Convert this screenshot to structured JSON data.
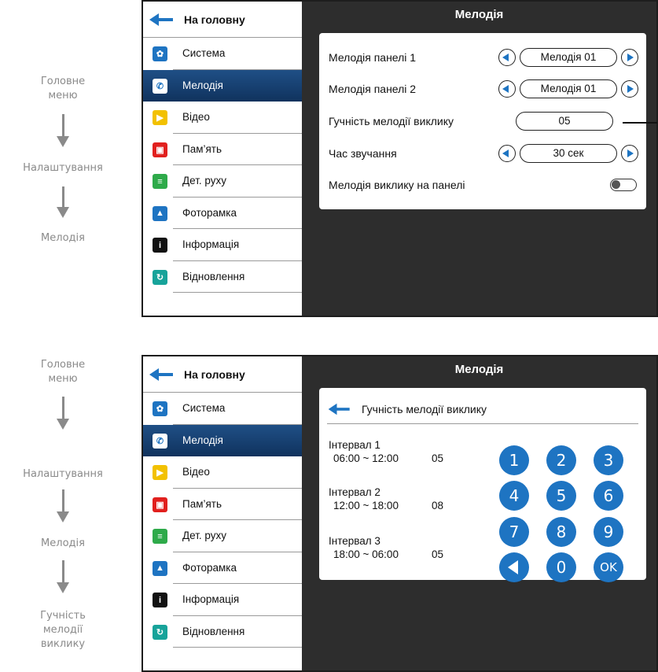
{
  "flow_top": [
    "Головне\nменю",
    "Налаштування",
    "Мелодія"
  ],
  "flow_bottom": [
    "Головне\nменю",
    "Налаштування",
    "Мелодія",
    "Гучність\nмелодії\nвиклику"
  ],
  "menu": {
    "home": "На головну",
    "items": [
      {
        "label": "Система",
        "icon": "gear-icon",
        "color": "#1e74c2"
      },
      {
        "label": "Мелодія",
        "icon": "phone-icon",
        "color": "#1e74c2"
      },
      {
        "label": "Відео",
        "icon": "play-icon",
        "color": "#f2c100"
      },
      {
        "label": "Пам’ять",
        "icon": "memory-icon",
        "color": "#e1201e"
      },
      {
        "label": "Дет. руху",
        "icon": "motion-icon",
        "color": "#2eaa4a"
      },
      {
        "label": "Фоторамка",
        "icon": "picture-icon",
        "color": "#1e74c2"
      },
      {
        "label": "Інформація",
        "icon": "info-icon",
        "color": "#111111"
      },
      {
        "label": "Відновлення",
        "icon": "restore-icon",
        "color": "#17a39a"
      }
    ]
  },
  "screen_title": "Мелодія",
  "settings": {
    "panel1": {
      "label": "Мелодія панелі 1",
      "value": "Мелодія 01"
    },
    "panel2": {
      "label": "Мелодія панелі 2",
      "value": "Мелодія 01"
    },
    "volume": {
      "label": "Гучність мелодії виклику",
      "value": "05"
    },
    "duration": {
      "label": "Час звучання",
      "value": "30 сек"
    },
    "on_panel": {
      "label": "Мелодія виклику на панелі",
      "enabled": false
    }
  },
  "keypad_screen": {
    "header": "Гучність мелодії виклику",
    "intervals": [
      {
        "name": "Інтервал 1",
        "range": "06:00 ~ 12:00",
        "value": "05"
      },
      {
        "name": "Інтервал 2",
        "range": "12:00 ~ 18:00",
        "value": "08"
      },
      {
        "name": "Інтервал 3",
        "range": "18:00 ~ 06:00",
        "value": "05"
      }
    ],
    "keys": [
      "1",
      "2",
      "3",
      "4",
      "5",
      "6",
      "7",
      "8",
      "9",
      "0",
      "OK"
    ]
  },
  "accent_color": "#1e74c2"
}
